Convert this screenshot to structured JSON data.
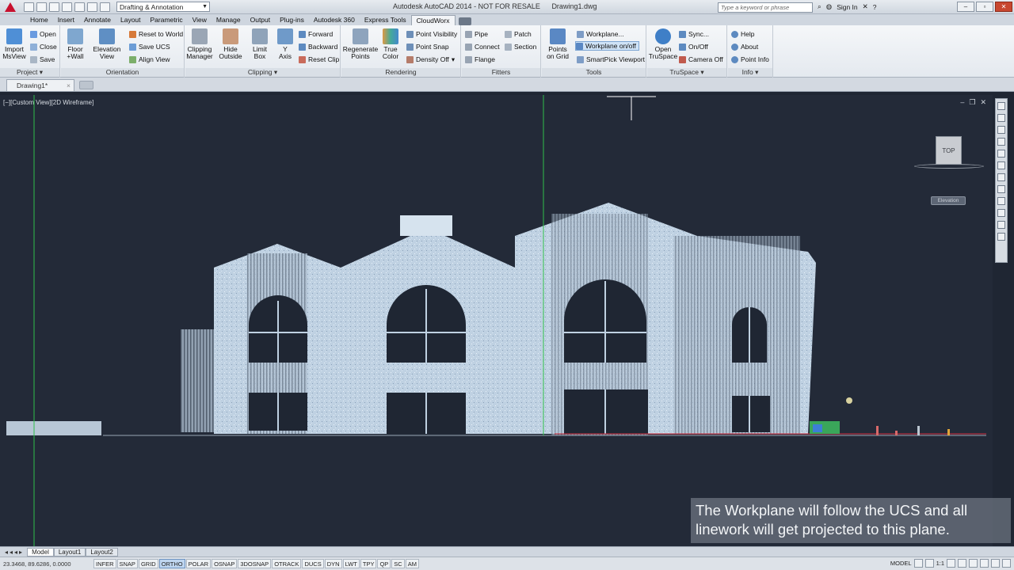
{
  "titlebar": {
    "workspace": "Drafting & Annotation",
    "app_title": "Autodesk AutoCAD 2014 - NOT FOR RESALE",
    "file_name": "Drawing1.dwg",
    "search_placeholder": "Type a keyword or phrase",
    "sign_in": "Sign In"
  },
  "ribbon_tabs": [
    "Home",
    "Insert",
    "Annotate",
    "Layout",
    "Parametric",
    "View",
    "Manage",
    "Output",
    "Plug-ins",
    "Autodesk 360",
    "Express Tools",
    "CloudWorx"
  ],
  "ribbon": {
    "project": {
      "title": "Project",
      "import": "Import\nMsView",
      "open": "Open",
      "close": "Close",
      "save": "Save"
    },
    "orientation": {
      "title": "Orientation",
      "floor": "Floor\n+Wall",
      "elevation": "Elevation\nView",
      "reset": "Reset to World",
      "save_ucs": "Save UCS",
      "align": "Align View"
    },
    "clipping": {
      "title": "Clipping",
      "manager": "Clipping\nManager",
      "hide": "Hide\nOutside",
      "limit": "Limit\nBox",
      "yaxis": "Y\nAxis",
      "forward": "Forward",
      "backward": "Backward",
      "reset": "Reset Clip"
    },
    "rendering": {
      "title": "Rendering",
      "regen": "Regenerate\nPoints",
      "true_color": "True\nColor",
      "visibility": "Point Visibility",
      "snap": "Point Snap",
      "density": "Density Off"
    },
    "fitters": {
      "title": "Fitters",
      "pipe": "Pipe",
      "connect": "Connect",
      "flange": "Flange",
      "patch": "Patch",
      "section": "Section"
    },
    "tools": {
      "title": "Tools",
      "points_grid": "Points\non Grid",
      "workplane": "Workplane...",
      "workplane_toggle": "Workplane on/off",
      "smartpick": "SmartPick Viewport"
    },
    "truspace": {
      "title": "TruSpace",
      "open": "Open\nTruSpace",
      "sync": "Sync...",
      "onoff": "On/Off",
      "camera": "Camera Off"
    },
    "info": {
      "title": "Info",
      "help": "Help",
      "about": "About",
      "point_info": "Point Info"
    }
  },
  "file_tab": "Drawing1*",
  "viewport": {
    "label": "[−][Custom View][2D Wireframe]",
    "viewcube": "TOP",
    "elevation_chip": "Elevation"
  },
  "caption": "The Workplane will follow the UCS and all linework will get projected to this plane.",
  "layout_tabs": [
    "Model",
    "Layout1",
    "Layout2"
  ],
  "status": {
    "coords": "23.3468, 89.6286, 0.0000",
    "toggles": [
      "INFER",
      "SNAP",
      "GRID",
      "ORTHO",
      "POLAR",
      "OSNAP",
      "3DOSNAP",
      "OTRACK",
      "DUCS",
      "DYN",
      "LWT",
      "TPY",
      "QP",
      "SC",
      "AM"
    ],
    "active_toggle": "ORTHO",
    "space": "MODEL",
    "scale": "1:1"
  },
  "colors": {
    "background": "#232a38",
    "ucs_green": "#2fbf4a",
    "facade": "#b9cde0",
    "ground_line": "#d32f3f"
  }
}
